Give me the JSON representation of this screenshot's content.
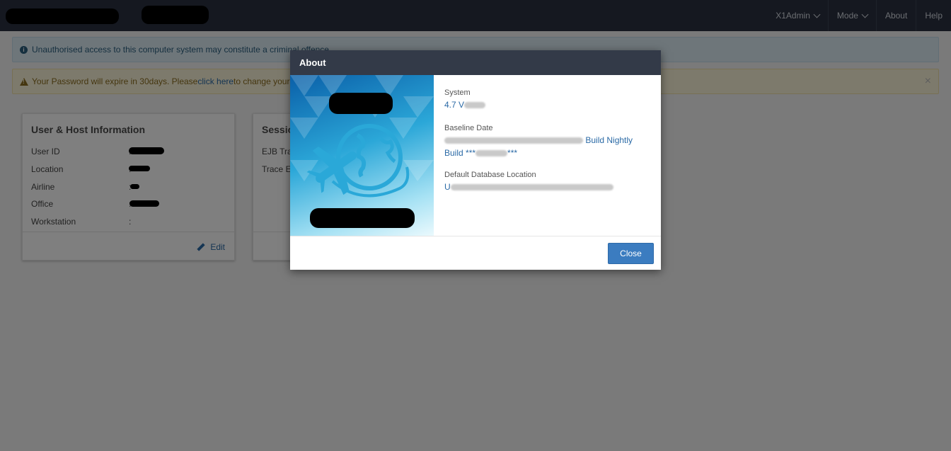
{
  "nav": {
    "items": [
      {
        "label": "X1Admin",
        "has_dropdown": true
      },
      {
        "label": "Mode",
        "has_dropdown": true
      },
      {
        "label": "About",
        "has_dropdown": false
      },
      {
        "label": "Help",
        "has_dropdown": false
      }
    ]
  },
  "alerts": {
    "info": {
      "text": "Unauthorised access to this computer system may constitute a criminal offence"
    },
    "warning": {
      "prefix": "Your Password will expire in 30days. Please ",
      "link": "click here",
      "suffix": " to change your pa",
      "close": "×"
    }
  },
  "card_user": {
    "title": "User & Host Information",
    "rows": [
      {
        "label": "User ID",
        "sep": ":"
      },
      {
        "label": "Location",
        "sep": ":"
      },
      {
        "label": "Airline",
        "sep": ":"
      },
      {
        "label": "Office",
        "sep": ":"
      },
      {
        "label": "Workstation",
        "sep": ":"
      }
    ],
    "edit_label": "Edit"
  },
  "card_session": {
    "title": "Sessio",
    "rows": [
      {
        "label": "EJB Tra"
      },
      {
        "label": "Trace E"
      }
    ]
  },
  "modal": {
    "title": "About",
    "system_label": "System",
    "system_value": "4.7 V",
    "baseline_label": "Baseline Date",
    "baseline_value_end": "Build Nightly",
    "baseline_value_line2": "Build ***",
    "baseline_value_line2_end": "***",
    "db_label": "Default Database Location",
    "db_value": "U",
    "close_label": "Close"
  },
  "colors": {
    "nav_bg": "#2a3140",
    "primary": "#3b7cc0",
    "link": "#2b6aa6"
  }
}
